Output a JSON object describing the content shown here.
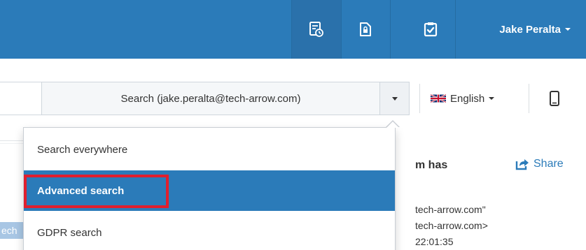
{
  "header": {
    "user_name": "Jake Peralta",
    "icons": [
      "report-icon",
      "locked-file-icon",
      "clipboard-check-icon"
    ]
  },
  "toolbar": {
    "search_button_label": "Search (jake.peralta@tech-arrow.com)",
    "language_label": "English",
    "language_flag": "uk-flag-icon",
    "mobile_icon": "mobile-phone-icon"
  },
  "search_menu": {
    "items": [
      {
        "label": "Search everywhere",
        "selected": false
      },
      {
        "label": "Advanced search",
        "selected": true
      },
      {
        "label": "GDPR search",
        "selected": false
      }
    ]
  },
  "background": {
    "title_fragment": "m has",
    "share_label": "Share",
    "lines": [
      "tech-arrow.com\"",
      "tech-arrow.com>",
      "22:01:35"
    ],
    "left_fragment": "ech"
  },
  "colors": {
    "primary": "#2b7bb9",
    "highlight_border": "#e01f2e"
  }
}
